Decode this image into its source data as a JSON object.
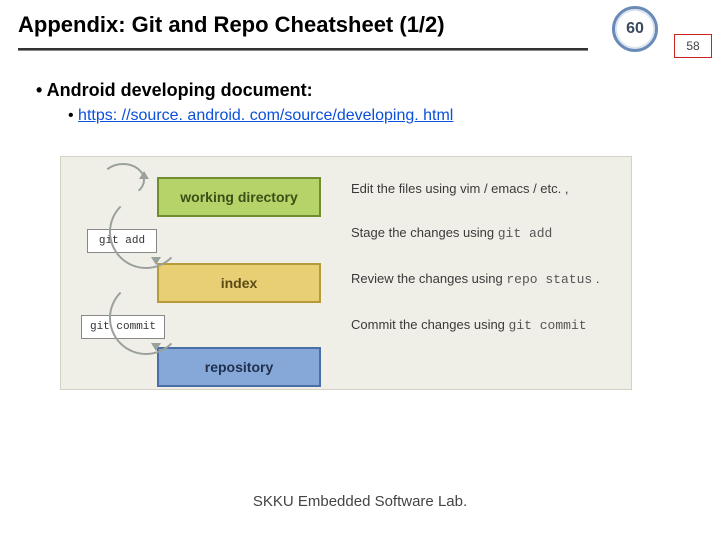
{
  "header": {
    "title": "Appendix: Git and Repo Cheatsheet (1/2)",
    "badge_main": "60",
    "badge_sub": "58"
  },
  "content": {
    "bullet1": "Android developing document:",
    "link_text": "https: //source. android. com/source/developing. html"
  },
  "diagram": {
    "stages": {
      "working_directory": "working directory",
      "index": "index",
      "repository": "repository"
    },
    "commands": {
      "git_add": "git add",
      "git_commit": "git commit"
    },
    "descriptions": {
      "edit_prefix": "Edit the files using vim / emacs / etc. ,",
      "stage_prefix": "Stage the changes using ",
      "stage_cmd": "git add",
      "review_prefix": "Review the changes using ",
      "review_cmd": "repo status",
      "review_suffix": " .",
      "commit_prefix": "Commit the changes using ",
      "commit_cmd": "git commit"
    }
  },
  "footer": {
    "text": "SKKU Embedded Software Lab."
  }
}
